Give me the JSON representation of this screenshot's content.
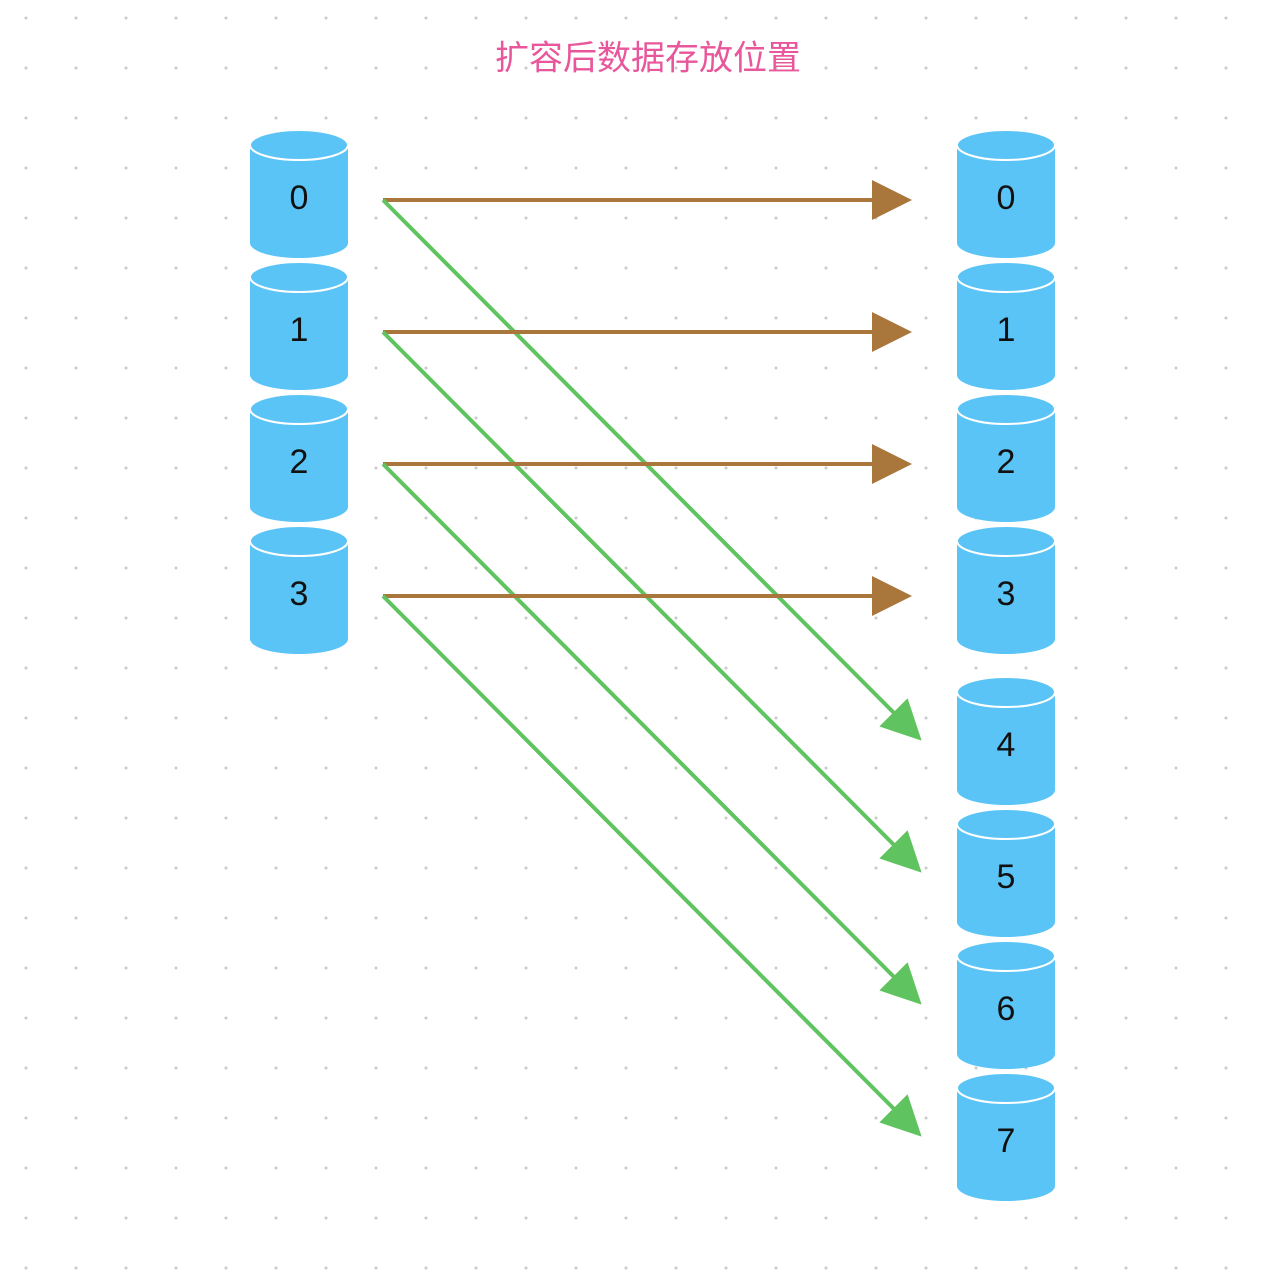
{
  "title": "扩容后数据存放位置",
  "colors": {
    "title": "#e8579b",
    "cylinder": "#5bc4f6",
    "cylinder_edge": "#ffffff",
    "arrow_same": "#a9763b",
    "arrow_new": "#5fc45f",
    "grid_dot": "#c9c9c9"
  },
  "before": {
    "buckets": [
      "0",
      "1",
      "2",
      "3"
    ]
  },
  "after": {
    "buckets": [
      "0",
      "1",
      "2",
      "3",
      "4",
      "5",
      "6",
      "7"
    ]
  },
  "mappings": [
    {
      "from": "0",
      "to": "0",
      "kind": "same"
    },
    {
      "from": "0",
      "to": "4",
      "kind": "new"
    },
    {
      "from": "1",
      "to": "1",
      "kind": "same"
    },
    {
      "from": "1",
      "to": "5",
      "kind": "new"
    },
    {
      "from": "2",
      "to": "2",
      "kind": "same"
    },
    {
      "from": "2",
      "to": "6",
      "kind": "new"
    },
    {
      "from": "3",
      "to": "3",
      "kind": "same"
    },
    {
      "from": "3",
      "to": "7",
      "kind": "new"
    }
  ]
}
